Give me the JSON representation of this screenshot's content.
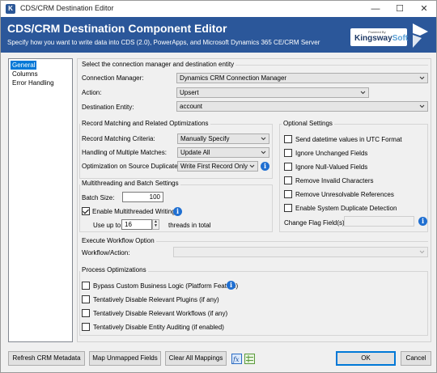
{
  "window": {
    "title": "CDS/CRM Destination Editor",
    "app_icon": "K",
    "minimize": "—",
    "maximize": "☐",
    "close": "✕"
  },
  "header": {
    "title": "CDS/CRM Destination Component Editor",
    "subtitle": "Specify how you want to write data into CDS (2.0), PowerApps, and Microsoft Dynamics 365 CE/CRM Server",
    "logo_powered_by": "Powered By",
    "logo_kingsway": "Kingsway",
    "logo_soft": "Soft"
  },
  "nav": {
    "items": [
      {
        "label": "General",
        "selected": true
      },
      {
        "label": "Columns",
        "selected": false
      },
      {
        "label": "Error Handling",
        "selected": false
      }
    ]
  },
  "connection": {
    "section_title": "Select the connection manager and destination entity",
    "manager_label": "Connection Manager:",
    "manager_value": "Dynamics CRM Connection Manager",
    "action_label": "Action:",
    "action_value": "Upsert",
    "entity_label": "Destination Entity:",
    "entity_value": "account"
  },
  "matching": {
    "section_title": "Record Matching and Related Optimizations",
    "criteria_label": "Record Matching Criteria:",
    "criteria_value": "Manually Specify",
    "multiple_label": "Handling of Multiple Matches:",
    "multiple_value": "Update All",
    "duplicates_label": "Optimization on Source Duplicates:",
    "duplicates_value": "Write First Record Only"
  },
  "multithread": {
    "section_title": "Multithreading and Batch Settings",
    "batch_label": "Batch Size:",
    "batch_value": "100",
    "enable_label": "Enable Multithreaded Writing",
    "enable_checked": true,
    "use_up_to_label": "Use up to",
    "threads_value": "16",
    "threads_suffix": "threads in total"
  },
  "optional": {
    "section_title": "Optional Settings",
    "options": [
      {
        "label": "Send datetime values in UTC Format",
        "checked": false
      },
      {
        "label": "Ignore Unchanged Fields",
        "checked": false
      },
      {
        "label": "Ignore Null-Valued Fields",
        "checked": false
      },
      {
        "label": "Remove Invalid Characters",
        "checked": false
      },
      {
        "label": "Remove Unresolvable References",
        "checked": false
      },
      {
        "label": "Enable System Duplicate Detection",
        "checked": false
      }
    ],
    "change_flag_label": "Change Flag Field(s):",
    "change_flag_value": ""
  },
  "workflow": {
    "section_title": "Execute Workflow Option",
    "action_label": "Workflow/Action:",
    "action_value": ""
  },
  "process": {
    "section_title": "Process Optimizations",
    "options": [
      {
        "label": "Bypass Custom Business Logic (Platform Feature)",
        "checked": false
      },
      {
        "label": "Tentatively Disable Relevant Plugins (if any)",
        "checked": false
      },
      {
        "label": "Tentatively Disable Relevant Workflows (if any)",
        "checked": false
      },
      {
        "label": "Tentatively Disable Entity Auditing (if enabled)",
        "checked": false
      }
    ]
  },
  "footer": {
    "refresh_label": "Refresh CRM Metadata",
    "map_label": "Map Unmapped Fields",
    "clear_label": "Clear All Mappings",
    "ok_label": "OK",
    "cancel_label": "Cancel"
  },
  "icons": {
    "info": "i",
    "accent": "#2b579a",
    "selection": "#0078d7",
    "info_color": "#1f6fd1"
  }
}
